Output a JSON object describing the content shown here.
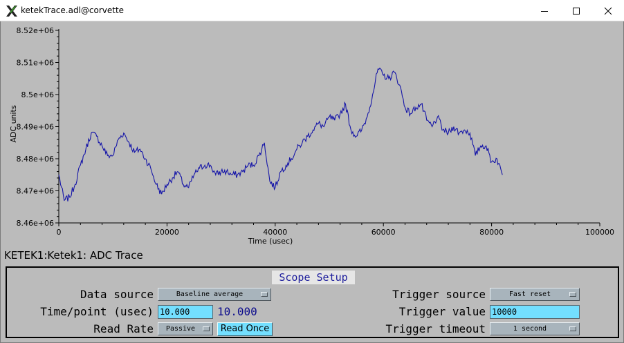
{
  "window": {
    "title": "ketekTrace.adl@corvette"
  },
  "chart_data": {
    "type": "line",
    "xlabel": "Time (usec)",
    "ylabel": "ADC units",
    "xlim": [
      0,
      100000
    ],
    "ylim": [
      8460000,
      8520000
    ],
    "x_ticks": [
      "0",
      "20000",
      "40000",
      "60000",
      "80000",
      "100000"
    ],
    "y_ticks": [
      "8.46e+06",
      "8.47e+06",
      "8.48e+06",
      "8.49e+06",
      "8.5e+06",
      "8.51e+06",
      "8.52e+06"
    ],
    "grid": false,
    "line_color": "#1515a8",
    "series": [
      {
        "x": [
          0,
          1000,
          2000,
          3000,
          4000,
          5000,
          6000,
          7000,
          8000,
          9000,
          10000,
          11000,
          12000,
          13000,
          14000,
          15000,
          16000,
          17000,
          18000,
          19000,
          20000,
          21000,
          22000,
          23000,
          24000,
          25000,
          26000,
          27000,
          28000,
          29000,
          30000,
          31000,
          32000,
          33000,
          34000,
          35000,
          36000,
          37000,
          38000,
          39000,
          40000,
          41000,
          42000,
          43000,
          44000,
          45000,
          46000,
          47000,
          48000,
          49000,
          50000,
          51000,
          52000,
          53000,
          54000,
          55000,
          56000,
          57000,
          58000,
          59000,
          60000,
          61000,
          62000,
          63000,
          64000,
          65000,
          66000,
          67000,
          68000,
          69000,
          70000,
          71000,
          72000,
          73000,
          74000,
          75000,
          76000,
          77000,
          78000,
          79000,
          80000,
          81000,
          82000
        ],
        "y": [
          8475000,
          8467000,
          8468000,
          8472000,
          8478000,
          8483000,
          8488000,
          8487000,
          8484000,
          8481000,
          8481000,
          8486000,
          8488000,
          8485000,
          8482000,
          8483000,
          8480000,
          8477000,
          8472000,
          8469000,
          8472000,
          8474000,
          8476000,
          8472000,
          8471000,
          8475000,
          8477000,
          8478000,
          8478000,
          8475000,
          8476000,
          8476000,
          8475000,
          8475000,
          8476000,
          8478000,
          8478000,
          8481000,
          8485000,
          8473000,
          8471000,
          8476000,
          8478000,
          8480000,
          8483000,
          8485000,
          8487000,
          8489000,
          8491000,
          8490000,
          8493000,
          8492000,
          8494000,
          8497000,
          8489000,
          8487000,
          8489000,
          8493000,
          8500000,
          8508000,
          8506000,
          8505000,
          8507000,
          8503000,
          8496000,
          8494000,
          8496000,
          8497000,
          8492000,
          8490000,
          8493000,
          8489000,
          8488000,
          8490000,
          8488000,
          8489000,
          8488000,
          8481000,
          8484000,
          8484000,
          8479000,
          8480000,
          8475000
        ]
      }
    ]
  },
  "pv_label": "KETEK1:Ketek1: ADC Trace",
  "scope": {
    "title": "Scope Setup",
    "data_source_label": "Data source",
    "data_source_value": "Baseline average",
    "time_point_label": "Time/point (usec)",
    "time_point_value": "10.000",
    "time_point_readback": "10.000",
    "read_rate_label": "Read Rate",
    "read_rate_value": "Passive",
    "read_once_label": "Read Once",
    "trigger_source_label": "Trigger source",
    "trigger_source_value": "Fast reset",
    "trigger_value_label": "Trigger value",
    "trigger_value_value": "10000",
    "trigger_timeout_label": "Trigger timeout",
    "trigger_timeout_value": "1 second"
  }
}
